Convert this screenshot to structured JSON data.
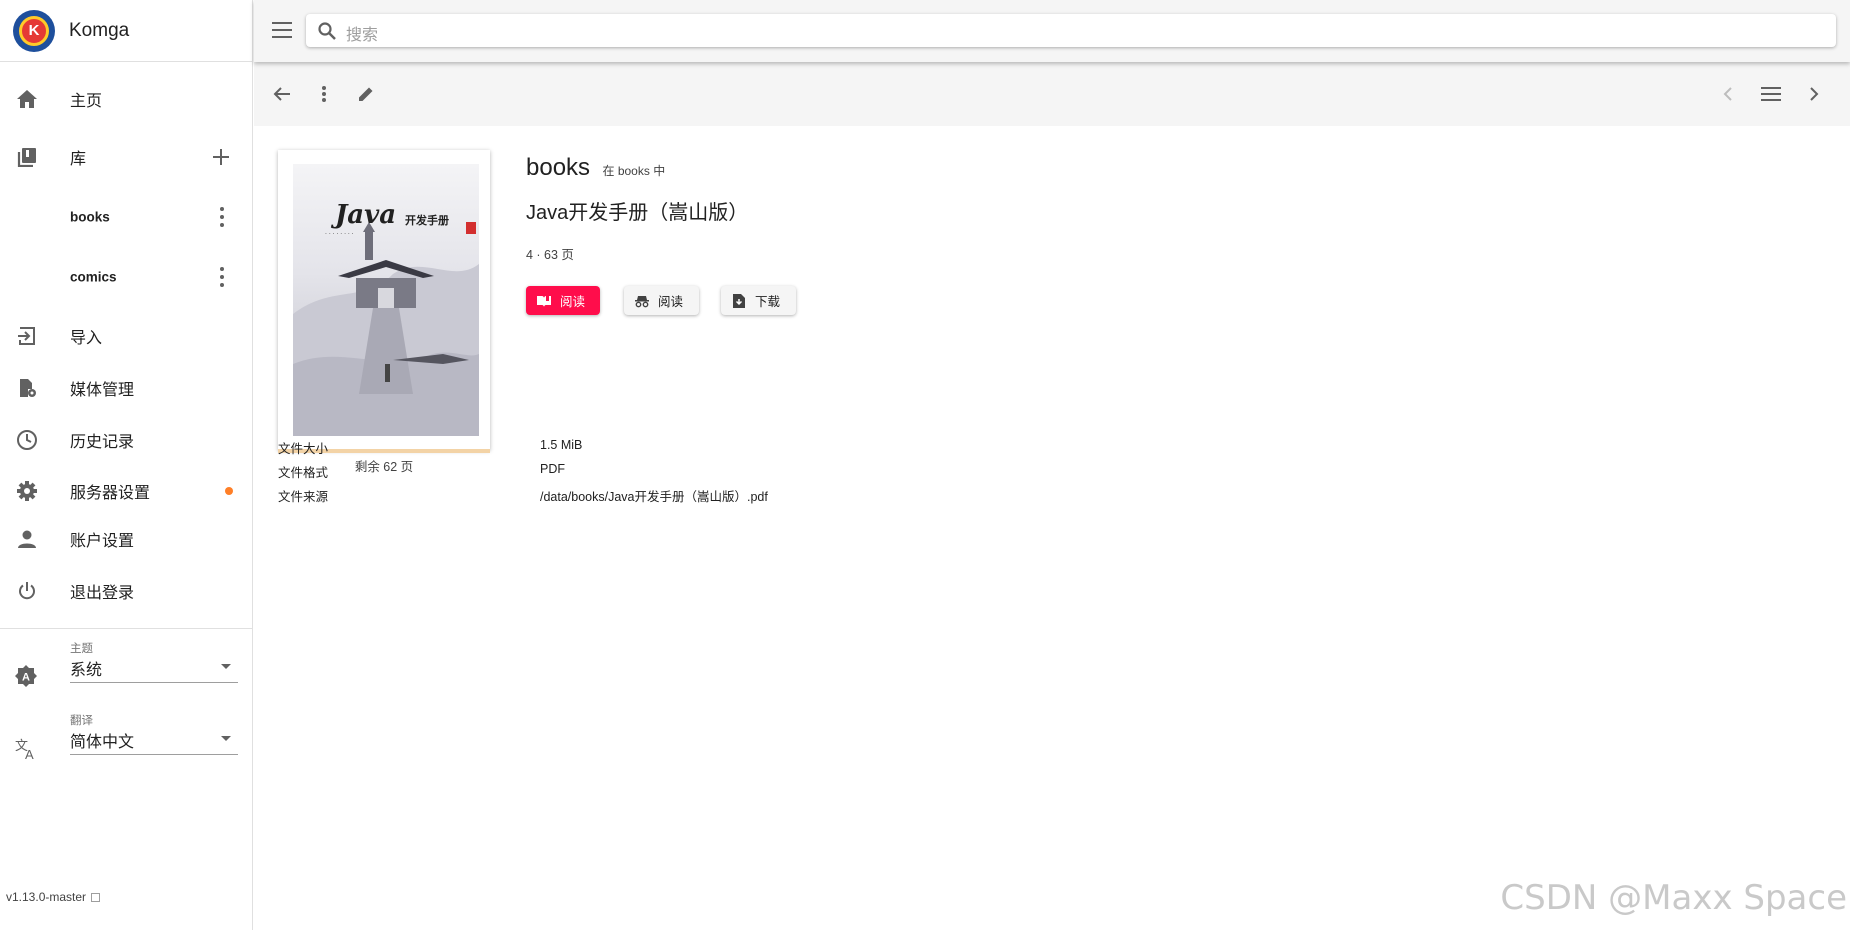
{
  "app": {
    "name": "Komga",
    "version": "v1.13.0-master"
  },
  "sidebar": {
    "home": "主页",
    "library": "库",
    "libraries": [
      {
        "label": "books"
      },
      {
        "label": "comics"
      }
    ],
    "import": "导入",
    "media_management": "媒体管理",
    "history": "历史记录",
    "server_settings": "服务器设置",
    "account_settings": "账户设置",
    "logout": "退出登录",
    "theme": {
      "caption": "主题",
      "value": "系统"
    },
    "language": {
      "caption": "翻译",
      "value": "简体中文"
    }
  },
  "search": {
    "placeholder": "搜索"
  },
  "book": {
    "series": "books",
    "in_library": "在 books 中",
    "title": "Java开发手册（嵩山版）",
    "pages": "4 · 63 页",
    "remaining": "剩余 62 页",
    "progress_fraction": 0.016,
    "cover_text": {
      "title": "Java",
      "subtitle": "开发手册"
    }
  },
  "actions": {
    "read": "阅读",
    "read_incognito": "阅读",
    "download": "下载"
  },
  "file_info": [
    {
      "key": "文件大小",
      "value": "1.5 MiB"
    },
    {
      "key": "文件格式",
      "value": "PDF"
    },
    {
      "key": "文件来源",
      "value": "/data/books/Java开发手册（嵩山版）.pdf"
    }
  ],
  "watermark": "CSDN @Maxx Space",
  "colors": {
    "accent": "#ff0d4b",
    "notification_dot": "#ff7f27",
    "logo_blue": "#1e4f9c"
  }
}
